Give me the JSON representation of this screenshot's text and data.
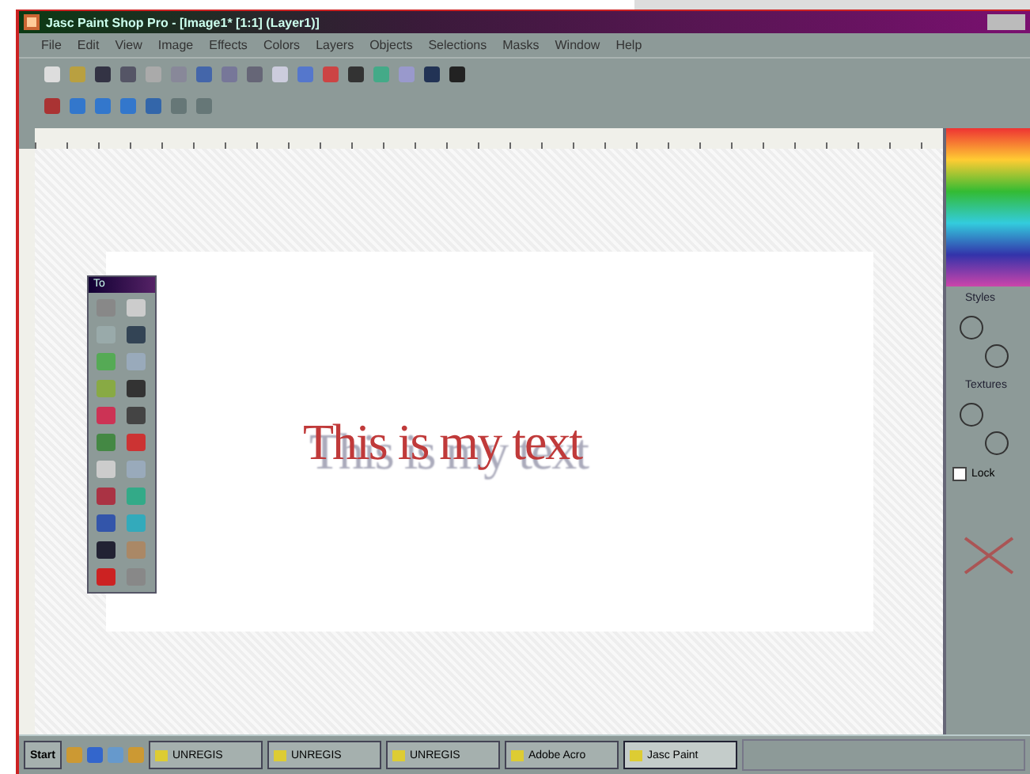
{
  "window": {
    "title": "Jasc Paint Shop Pro - [Image1* [1:1] (Layer1)]"
  },
  "menu": [
    "File",
    "Edit",
    "View",
    "Image",
    "Effects",
    "Colors",
    "Layers",
    "Objects",
    "Selections",
    "Masks",
    "Window",
    "Help"
  ],
  "canvas": {
    "text": "This is my text"
  },
  "tool_palette": {
    "title": "To"
  },
  "right_panel": {
    "styles_label": "Styles",
    "textures_label": "Textures",
    "lock": {
      "label": "Lock",
      "checked": false
    }
  },
  "taskbar": {
    "start": "Start",
    "buttons": [
      {
        "label": "UNREGIS",
        "selected": false
      },
      {
        "label": "UNREGIS",
        "selected": false
      },
      {
        "label": "UNREGIS",
        "selected": false
      },
      {
        "label": "Adobe Acro",
        "selected": false
      },
      {
        "label": "Jasc Paint",
        "selected": true
      }
    ]
  }
}
